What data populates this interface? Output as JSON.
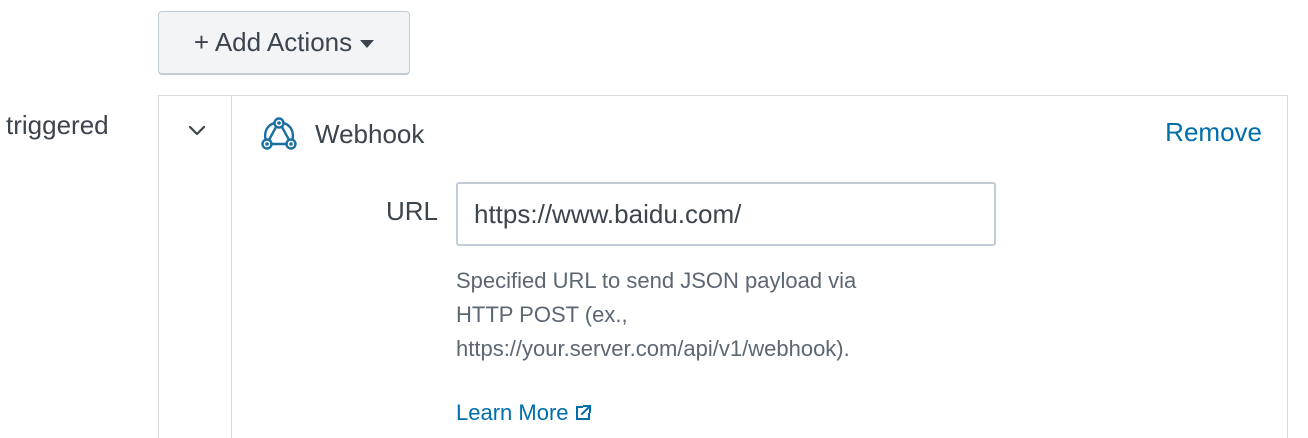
{
  "toolbar": {
    "add_actions_label": "+ Add Actions"
  },
  "trigger": {
    "label": "triggered"
  },
  "action": {
    "title": "Webhook",
    "icon": "webhook-icon",
    "remove_label": "Remove",
    "url_field": {
      "label": "URL",
      "value": "https://www.baidu.com/"
    },
    "help_text": "Specified URL to send JSON payload via HTTP POST (ex., https://your.server.com/api/v1/webhook).",
    "learn_more_label": "Learn More"
  },
  "colors": {
    "text": "#3c444d",
    "link": "#006eaa",
    "icon": "#1a6fa3",
    "border": "#d6dbe0",
    "button_bg": "#f2f4f5"
  }
}
